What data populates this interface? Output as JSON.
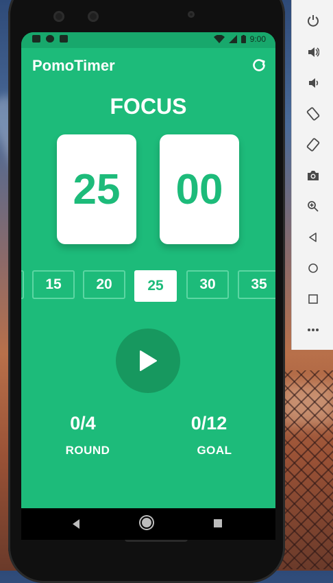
{
  "statusbar": {
    "time": "9:00"
  },
  "app": {
    "title": "PomoTimer"
  },
  "timer": {
    "mode": "FOCUS",
    "minutes": "25",
    "seconds": "00"
  },
  "chips": [
    {
      "label": "",
      "selected": false
    },
    {
      "label": "15",
      "selected": false
    },
    {
      "label": "20",
      "selected": false
    },
    {
      "label": "25",
      "selected": true
    },
    {
      "label": "30",
      "selected": false
    },
    {
      "label": "35",
      "selected": false
    }
  ],
  "stats": {
    "round": {
      "value": "0/4",
      "label": "ROUND"
    },
    "goal": {
      "value": "0/12",
      "label": "GOAL"
    }
  },
  "colors": {
    "primary": "#1dbb7a",
    "primary_dark": "#17985f",
    "chip_border": "#5cd6a3"
  },
  "icons": {
    "refresh": "refresh-icon",
    "play": "play-icon",
    "emulator_toolbar": [
      "power-icon",
      "volume-up-icon",
      "volume-down-icon",
      "rotate-left-icon",
      "rotate-right-icon",
      "camera-icon",
      "zoom-in-icon",
      "back-icon",
      "home-icon",
      "overview-icon",
      "more-icon"
    ]
  }
}
